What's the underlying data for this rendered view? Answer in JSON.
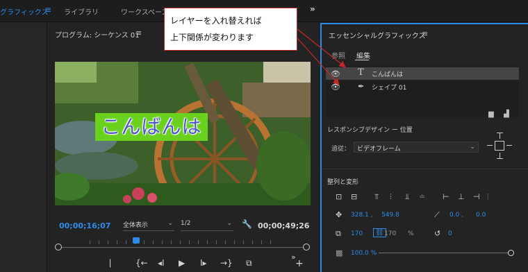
{
  "workspace_bar": {
    "active_label": "グラフィックス",
    "menu_icon": "hamburger-menu-icon",
    "items": [
      "ライブラリ",
      "ワークスペース"
    ],
    "more_icon": "double-chevron-right-icon"
  },
  "program_monitor": {
    "title": "プログラム: シーケンス 01",
    "menu_icon": "hamburger-menu-icon",
    "video_overlay_text": "こんばんは",
    "timecode_current": "00;00;16;07",
    "zoom_select": "全体表示",
    "resolution_select": "1/2",
    "timecode_duration": "00;00;49;26",
    "playback_progress": 0.33,
    "controls": [
      "mark-in-icon",
      "go-to-in-icon",
      "step-back-icon",
      "play-icon",
      "step-forward-icon",
      "go-to-out-icon",
      "export-frame-icon",
      "add-button-icon"
    ]
  },
  "essential_graphics": {
    "title": "エッセンシャルグラフィックス",
    "tabs": [
      "参照",
      "編集"
    ],
    "active_tab": "編集",
    "layers": [
      {
        "name": "こんばんは",
        "icon": "text-tool-icon",
        "selected": true
      },
      {
        "name": "シェイプ 01",
        "icon": "pen-tool-icon",
        "selected": false
      }
    ],
    "responsive_design_heading": "レスポンシブデザイン ー 位置",
    "pin_label": "追従：",
    "pin_target": "ビデオフレーム",
    "align_heading": "整列と変形",
    "position_x": "328.1 ,",
    "position_y": "549.8",
    "anchor_x": "0.0 ,",
    "anchor_y": "0.0",
    "scale": "170",
    "scale_linked": "170",
    "scale_unit": "%",
    "rotation": "0",
    "opacity": "100.0 %",
    "opacity_level": 1.0
  },
  "annotation": {
    "line1": "レイヤーを入れ替えれば",
    "line2": "上下関係が変わります"
  },
  "colors": {
    "accent": "#2d8ceb",
    "callout_border": "#c62828",
    "text_bg": "#6ad11f",
    "text_fill": "#4b57c5"
  }
}
